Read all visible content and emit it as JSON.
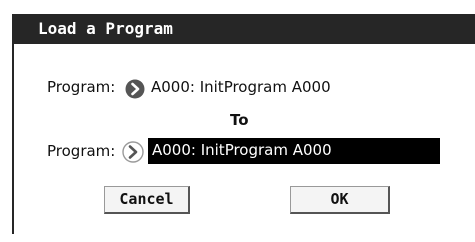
{
  "dialog": {
    "title": "Load a Program"
  },
  "source": {
    "label": "Program:",
    "value": "A000: InitProgram A000"
  },
  "to_label": "To",
  "destination": {
    "label": "Program:",
    "value": "A000: InitProgram A000"
  },
  "buttons": {
    "cancel": "Cancel",
    "ok": "OK"
  },
  "icons": {
    "source_arrow": "chevron-right-circle-filled",
    "destination_arrow": "chevron-right-circle-outline"
  },
  "colors": {
    "title_bar": "#262626",
    "selected_field": "#000000",
    "selected_text": "#ffffff"
  }
}
